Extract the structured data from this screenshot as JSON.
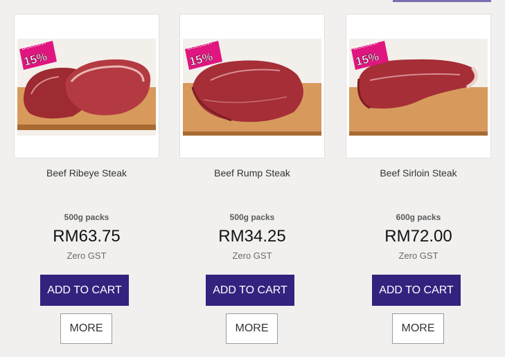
{
  "products": [
    {
      "name": "Beef Ribeye Steak",
      "pack": "500g packs",
      "price": "RM63.75",
      "gst": "Zero GST",
      "cart_label": "ADD TO CART",
      "more_label": "MORE",
      "badge_word": "DISCOUNT",
      "badge_pct": "15%"
    },
    {
      "name": "Beef Rump Steak",
      "pack": "500g packs",
      "price": "RM34.25",
      "gst": "Zero GST",
      "cart_label": "ADD TO CART",
      "more_label": "MORE",
      "badge_word": "DISCOUNT",
      "badge_pct": "15%"
    },
    {
      "name": "Beef Sirloin Steak",
      "pack": "600g packs",
      "price": "RM72.00",
      "gst": "Zero GST",
      "cart_label": "ADD TO CART",
      "more_label": "MORE",
      "badge_word": "DISCOUNT",
      "badge_pct": "15%"
    }
  ],
  "colors": {
    "cart_button": "#34227f",
    "badge": "#e0157f",
    "background": "#f1f0ef"
  }
}
